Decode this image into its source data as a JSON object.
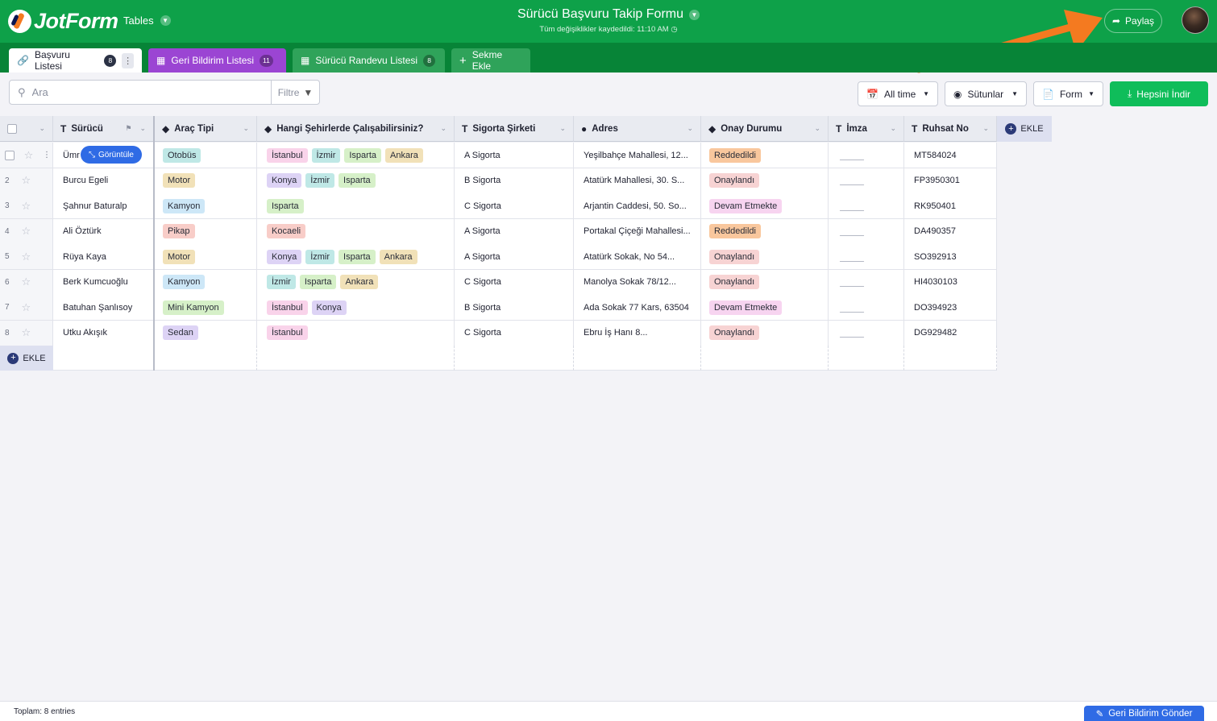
{
  "header": {
    "logo_text": "JotForm",
    "tables_label": "Tables",
    "form_title": "Sürücü Başvuru Takip Formu",
    "saved_note": "Tüm değişiklikler kaydedildi: 11:10 AM",
    "share_label": "Paylaş"
  },
  "tabs": [
    {
      "label": "Başvuru Listesi",
      "count": "8",
      "active": true,
      "icon": "link-icon"
    },
    {
      "label": "Geri Bildirim Listesi",
      "count": "11",
      "color": "#9b45d3",
      "icon": "table-icon"
    },
    {
      "label": "Sürücü Randevu Listesi",
      "count": "8",
      "color": "#2fa35a",
      "icon": "table-icon"
    },
    {
      "label": "Sekme Ekle",
      "color": "#2fa35a",
      "icon": "plus-icon"
    }
  ],
  "toolbar": {
    "search_placeholder": "Ara",
    "filter_label": "Filtre",
    "time_label": "All time",
    "columns_label": "Sütunlar",
    "form_label": "Form",
    "download_label": "Hepsini İndir"
  },
  "columns": [
    {
      "label": "Sürücü",
      "type": "T"
    },
    {
      "label": "Araç Tipi",
      "type": "tag"
    },
    {
      "label": "Hangi Şehirlerde Çalışabilirsiniz?",
      "type": "tag"
    },
    {
      "label": "Sigorta Şirketi",
      "type": "T"
    },
    {
      "label": "Adres",
      "type": "pin"
    },
    {
      "label": "Onay Durumu",
      "type": "tag"
    },
    {
      "label": "İmza",
      "type": "T"
    },
    {
      "label": "Ruhsat No",
      "type": "T"
    }
  ],
  "add_column_label": "EKLE",
  "view_label": "Görüntüle",
  "rows": [
    {
      "num": "",
      "name": "Ümr",
      "vehicle": "Otobüs",
      "vehicle_color": "#bfe8e6",
      "cities": [
        "İstanbul",
        "İzmir",
        "Isparta",
        "Ankara"
      ],
      "insurance": "A Sigorta",
      "address": "Yeşilbahçe Mahallesi, 12...",
      "status": "Reddedildi",
      "status_color": "#f9c79d",
      "license": "MT584024"
    },
    {
      "num": "2",
      "name": "Burcu Egeli",
      "vehicle": "Motor",
      "vehicle_color": "#f1e1b8",
      "cities": [
        "Konya",
        "İzmir",
        "Isparta"
      ],
      "insurance": "B Sigorta",
      "address": "Atatürk Mahallesi, 30. S...",
      "status": "Onaylandı",
      "status_color": "#f7d3d3",
      "license": "FP3950301"
    },
    {
      "num": "3",
      "name": "Şahnur Baturalp",
      "vehicle": "Kamyon",
      "vehicle_color": "#cde7f7",
      "cities": [
        "Isparta"
      ],
      "insurance": "C Sigorta",
      "address": "Arjantin Caddesi, 50. So...",
      "status": "Devam Etmekte",
      "status_color": "#f7d4f0",
      "license": "RK950401"
    },
    {
      "num": "4",
      "name": "Ali Öztürk",
      "vehicle": "Pikap",
      "vehicle_color": "#f8cdc8",
      "cities": [
        "Kocaeli"
      ],
      "insurance": "A Sigorta",
      "address": "Portakal Çiçeği Mahallesi...",
      "status": "Reddedildi",
      "status_color": "#f9c79d",
      "license": "DA490357"
    },
    {
      "num": "5",
      "name": "Rüya Kaya",
      "vehicle": "Motor",
      "vehicle_color": "#f1e1b8",
      "cities": [
        "Konya",
        "İzmir",
        "Isparta",
        "Ankara"
      ],
      "insurance": "A Sigorta",
      "address": "Atatürk Sokak, No 54...",
      "status": "Onaylandı",
      "status_color": "#f7d3d3",
      "license": "SO392913"
    },
    {
      "num": "6",
      "name": "Berk Kumcuoğlu",
      "vehicle": "Kamyon",
      "vehicle_color": "#cde7f7",
      "cities": [
        "İzmir",
        "Isparta",
        "Ankara"
      ],
      "insurance": "C Sigorta",
      "address": "Manolya Sokak 78/12...",
      "status": "Onaylandı",
      "status_color": "#f7d3d3",
      "license": "HI4030103"
    },
    {
      "num": "7",
      "name": "Batuhan Şanlısoy",
      "vehicle": "Mini Kamyon",
      "vehicle_color": "#d6f0c8",
      "cities": [
        "İstanbul",
        "Konya"
      ],
      "insurance": "B Sigorta",
      "address": "Ada Sokak 77 Kars, 63504",
      "status": "Devam Etmekte",
      "status_color": "#f7d4f0",
      "license": "DO394923"
    },
    {
      "num": "8",
      "name": "Utku Akışık",
      "vehicle": "Sedan",
      "vehicle_color": "#ddd3f5",
      "cities": [
        "İstanbul"
      ],
      "insurance": "C Sigorta",
      "address": "Ebru İş Hanı 8...",
      "status": "Onaylandı",
      "status_color": "#f7d3d3",
      "license": "DG929482"
    }
  ],
  "city_colors": {
    "İstanbul": "#f9d3ea",
    "İzmir": "#bfe8e6",
    "Isparta": "#d6f0c8",
    "Ankara": "#f1e1b8",
    "Konya": "#ddd3f5",
    "Kocaeli": "#f8cdc8"
  },
  "add_row_label": "EKLE",
  "footer": {
    "total": "Toplam: 8 entries",
    "feedback_label": "Geri Bildirim Gönder"
  },
  "colors": {
    "brand": "#0ea149",
    "brand_dark": "#078437",
    "accent_orange": "#f47a20",
    "link_blue": "#2f6be5"
  }
}
